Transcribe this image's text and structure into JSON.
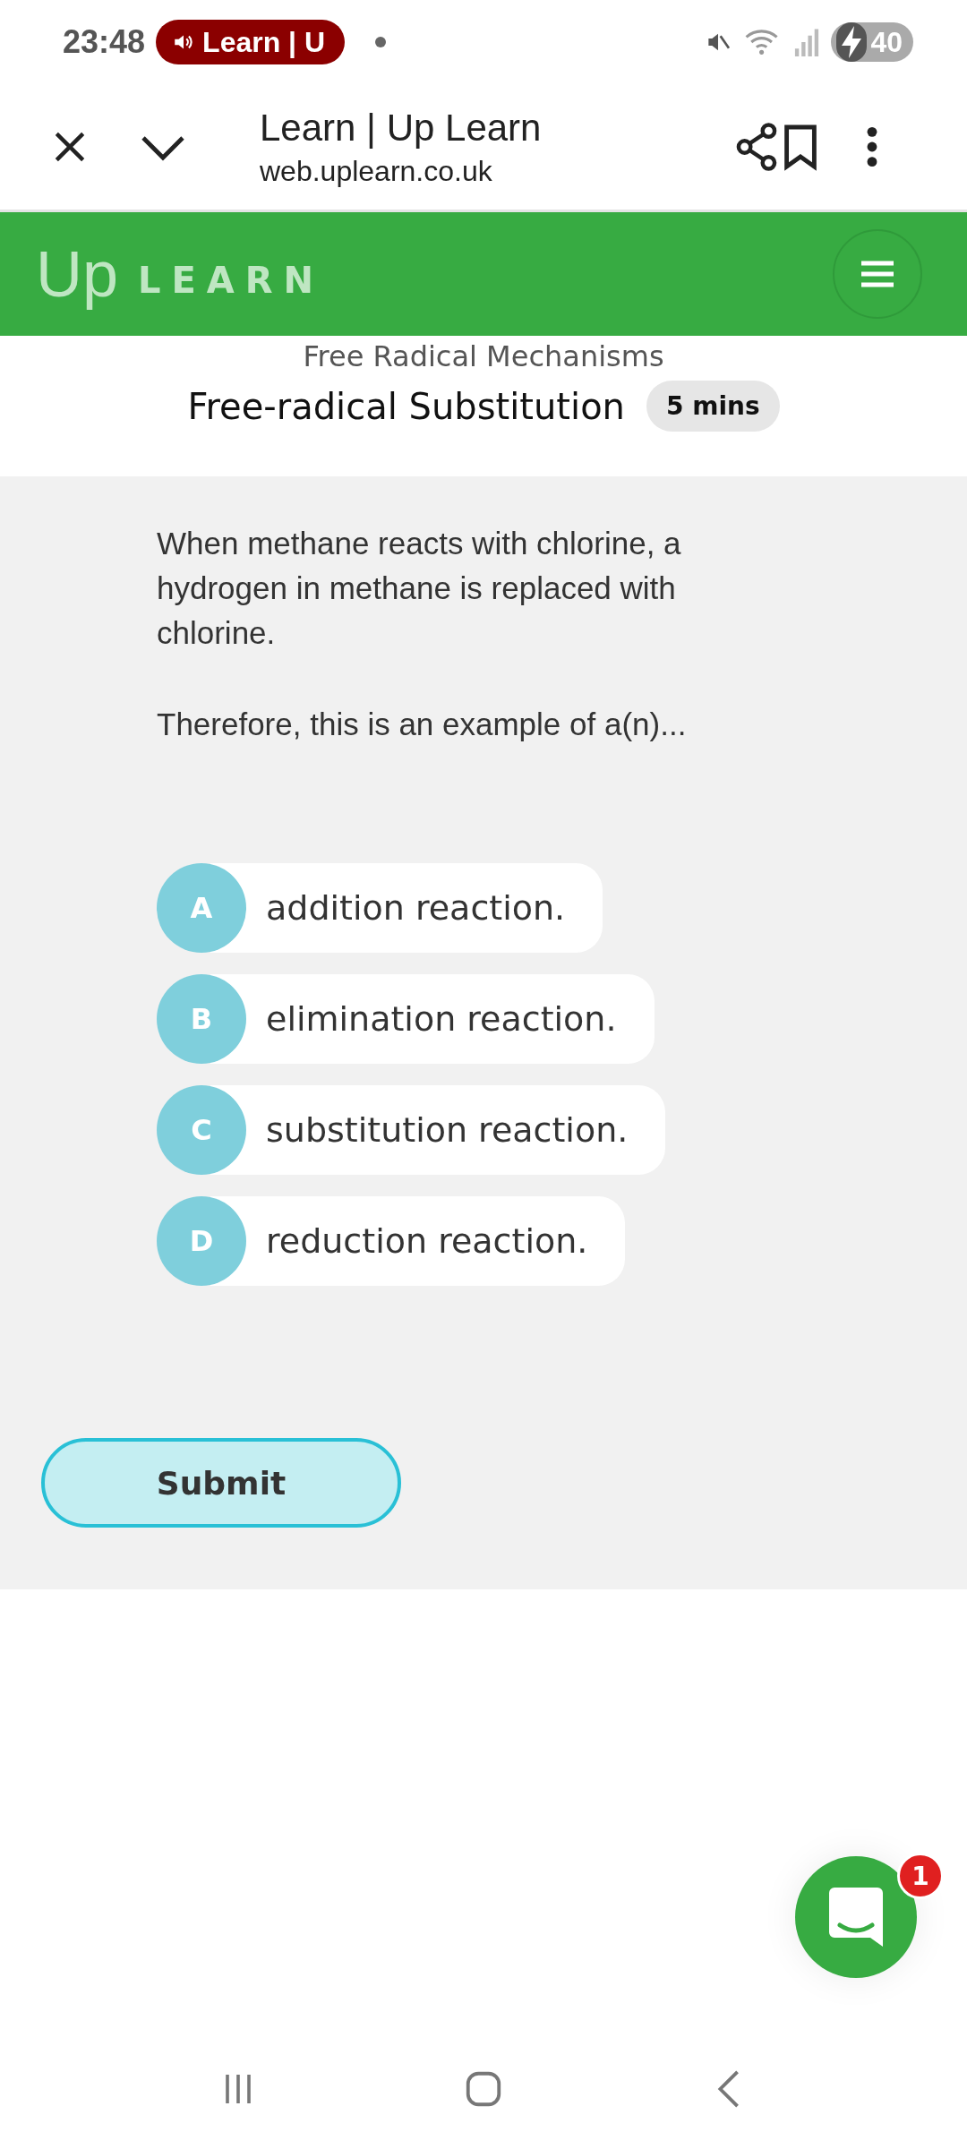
{
  "status_bar": {
    "time": "23:48",
    "media_chip": "Learn | U",
    "battery": "40"
  },
  "browser_bar": {
    "title": "Learn | Up Learn",
    "url": "web.uplearn.co.uk"
  },
  "site_header": {
    "logo_mark": "Up",
    "logo_word": "LEARN"
  },
  "lesson": {
    "section": "Free Radical Mechanisms",
    "title": "Free-radical Substitution",
    "duration": "5 mins"
  },
  "question": {
    "paragraphs": [
      "When methane reacts with chlorine, a hydrogen in methane is replaced with chlorine.",
      "Therefore, this is an example of a(n)..."
    ],
    "options": [
      {
        "letter": "A",
        "text": "addition reaction.",
        "selected": false
      },
      {
        "letter": "B",
        "text": "elimination reaction.",
        "selected": false
      },
      {
        "letter": "C",
        "text": "substitution reaction.",
        "selected": false
      },
      {
        "letter": "D",
        "text": "reduction reaction.",
        "selected": false
      }
    ]
  },
  "submit": {
    "label": "Submit"
  },
  "chat": {
    "badge": "1"
  }
}
